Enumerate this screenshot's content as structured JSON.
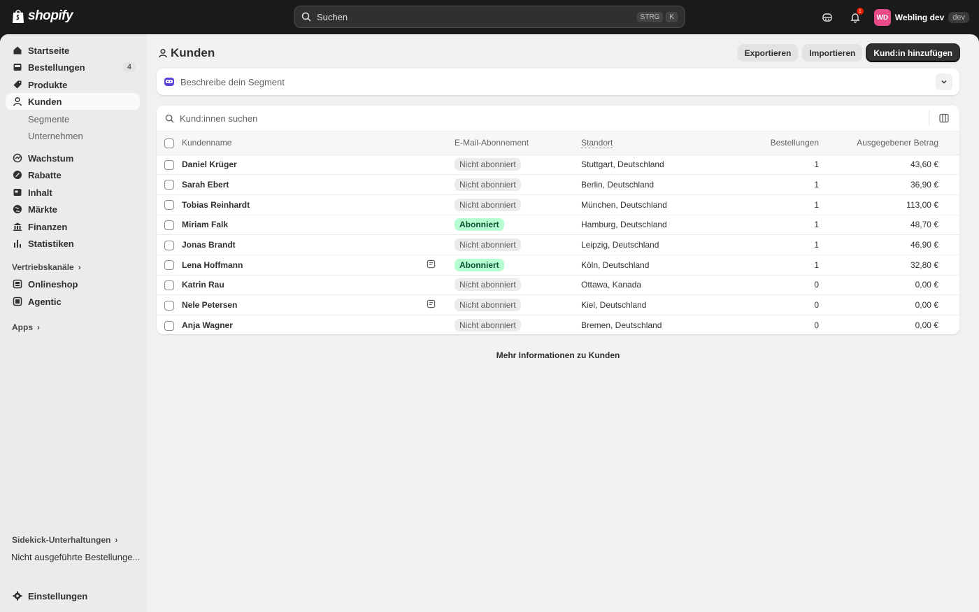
{
  "topbar": {
    "logo_text": "shopify",
    "search_placeholder": "Suchen",
    "shortcut_key1": "STRG",
    "shortcut_key2": "K",
    "notification_count": "1",
    "store_initials": "WD",
    "store_name": "Webling dev",
    "store_tag": "dev"
  },
  "sidebar": {
    "items": [
      {
        "label": "Startseite",
        "icon": "home-icon"
      },
      {
        "label": "Bestellungen",
        "icon": "orders-icon",
        "badge": "4"
      },
      {
        "label": "Produkte",
        "icon": "tag-icon"
      },
      {
        "label": "Kunden",
        "icon": "person-icon"
      }
    ],
    "sub_items": [
      "Segmente",
      "Unternehmen"
    ],
    "items2": [
      {
        "label": "Wachstum",
        "icon": "growth-icon"
      },
      {
        "label": "Rabatte",
        "icon": "discount-icon"
      },
      {
        "label": "Inhalt",
        "icon": "content-icon"
      },
      {
        "label": "Märkte",
        "icon": "globe-icon"
      },
      {
        "label": "Finanzen",
        "icon": "bank-icon"
      },
      {
        "label": "Statistiken",
        "icon": "bar-chart-icon"
      }
    ],
    "sales_channels_heading": "Vertriebskanäle",
    "channels": [
      {
        "label": "Onlineshop",
        "icon": "store-icon"
      },
      {
        "label": "Agentic",
        "icon": "agentic-icon"
      }
    ],
    "apps_heading": "Apps",
    "sidekick_heading": "Sidekick-Unterhaltungen",
    "sidekick_item": "Nicht ausgeführte Bestellunge...",
    "settings_label": "Einstellungen"
  },
  "page": {
    "title": "Kunden",
    "export_label": "Exportieren",
    "import_label": "Importieren",
    "add_label": "Kund:in hinzufügen",
    "segment_placeholder": "Beschreibe dein Segment",
    "table_search_placeholder": "Kund:innen suchen",
    "learn_more": "Mehr Informationen zu Kunden"
  },
  "table": {
    "headers": {
      "name": "Kundenname",
      "email": "E-Mail-Abonnement",
      "location": "Standort",
      "orders": "Bestellungen",
      "spent": "Ausgegebener Betrag"
    },
    "rows": [
      {
        "name": "Daniel Krüger",
        "email": "Nicht abonniert",
        "subscribed": false,
        "note": false,
        "location": "Stuttgart, Deutschland",
        "orders": "1",
        "spent": "43,60 €"
      },
      {
        "name": "Sarah Ebert",
        "email": "Nicht abonniert",
        "subscribed": false,
        "note": false,
        "location": "Berlin, Deutschland",
        "orders": "1",
        "spent": "36,90 €"
      },
      {
        "name": "Tobias Reinhardt",
        "email": "Nicht abonniert",
        "subscribed": false,
        "note": false,
        "location": "München, Deutschland",
        "orders": "1",
        "spent": "113,00 €"
      },
      {
        "name": "Miriam Falk",
        "email": "Abonniert",
        "subscribed": true,
        "note": false,
        "location": "Hamburg, Deutschland",
        "orders": "1",
        "spent": "48,70 €"
      },
      {
        "name": "Jonas Brandt",
        "email": "Nicht abonniert",
        "subscribed": false,
        "note": false,
        "location": "Leipzig, Deutschland",
        "orders": "1",
        "spent": "46,90 €"
      },
      {
        "name": "Lena Hoffmann",
        "email": "Abonniert",
        "subscribed": true,
        "note": true,
        "location": "Köln, Deutschland",
        "orders": "1",
        "spent": "32,80 €"
      },
      {
        "name": "Katrin Rau",
        "email": "Nicht abonniert",
        "subscribed": false,
        "note": false,
        "location": "Ottawa, Kanada",
        "orders": "0",
        "spent": "0,00 €"
      },
      {
        "name": "Nele Petersen",
        "email": "Nicht abonniert",
        "subscribed": false,
        "note": true,
        "location": "Kiel, Deutschland",
        "orders": "0",
        "spent": "0,00 €"
      },
      {
        "name": "Anja Wagner",
        "email": "Nicht abonniert",
        "subscribed": false,
        "note": false,
        "location": "Bremen, Deutschland",
        "orders": "0",
        "spent": "0,00 €"
      }
    ]
  },
  "colors": {
    "topbar": "#1a1a1a",
    "subscribed_bg": "#b4fed2",
    "avatar": "#e94b88",
    "primary_button": "#303030"
  }
}
